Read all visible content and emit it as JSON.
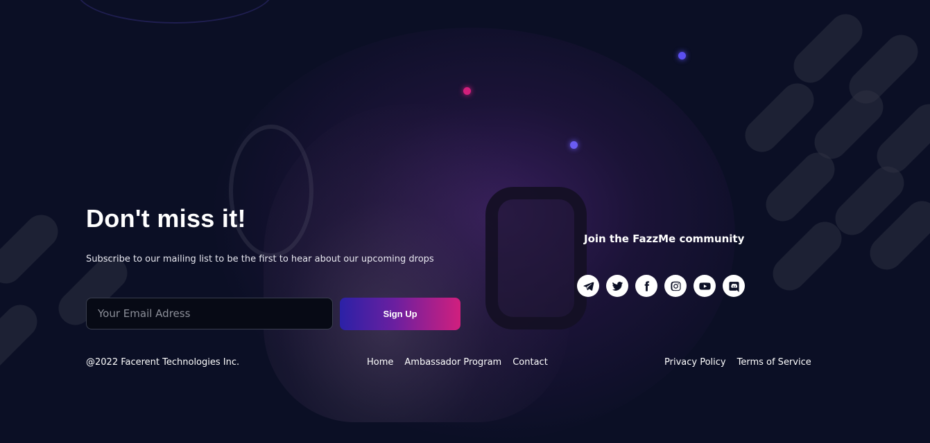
{
  "hero": {
    "title": "Don't miss it!",
    "subtitle": "Subscribe to our mailing list to be the first to hear about our upcoming drops"
  },
  "subscribe": {
    "email_placeholder": "Your Email Adress",
    "email_value": "",
    "button_label": "Sign Up"
  },
  "community": {
    "heading": "Join the FazzMe community",
    "socials": [
      {
        "name": "telegram-icon"
      },
      {
        "name": "twitter-icon"
      },
      {
        "name": "facebook-icon"
      },
      {
        "name": "instagram-icon"
      },
      {
        "name": "youtube-icon"
      },
      {
        "name": "discord-icon"
      }
    ]
  },
  "footer": {
    "copyright": "@2022 Facerent Technologies Inc.",
    "nav_links": [
      "Home",
      "Ambassador Program",
      "Contact"
    ],
    "legal_links": [
      "Privacy Policy",
      "Terms of Service"
    ]
  },
  "colors": {
    "background": "#0b0f25",
    "accent_pink": "#d11f7e",
    "accent_blue": "#2b21a6"
  }
}
